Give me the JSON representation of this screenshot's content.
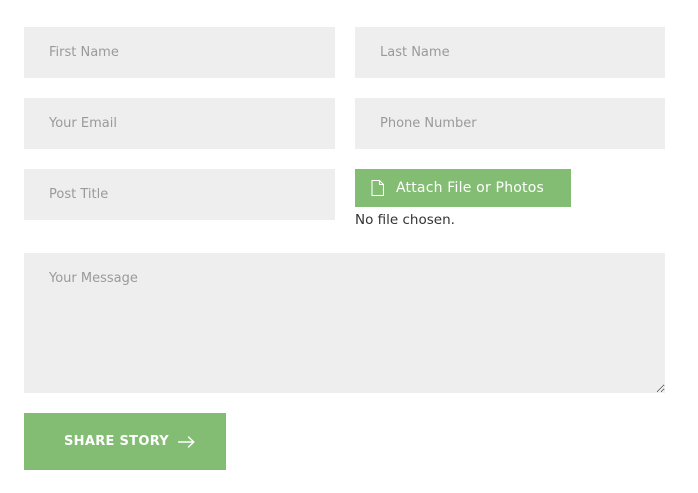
{
  "form": {
    "first_name": {
      "placeholder": "First Name",
      "value": ""
    },
    "last_name": {
      "placeholder": "Last Name",
      "value": ""
    },
    "email": {
      "placeholder": "Your Email",
      "value": ""
    },
    "phone": {
      "placeholder": "Phone Number",
      "value": ""
    },
    "post_title": {
      "placeholder": "Post Title",
      "value": ""
    },
    "message": {
      "placeholder": "Your Message",
      "value": ""
    },
    "attach": {
      "label": "Attach File or Photos",
      "icon": "file-icon",
      "status": "No file chosen."
    },
    "submit": {
      "label": "SHARE STORY",
      "icon": "arrow-right-icon"
    }
  },
  "colors": {
    "field_bg": "#eeeeee",
    "placeholder": "#9a9a9a",
    "accent": "#83bd73",
    "text": "#333333"
  }
}
